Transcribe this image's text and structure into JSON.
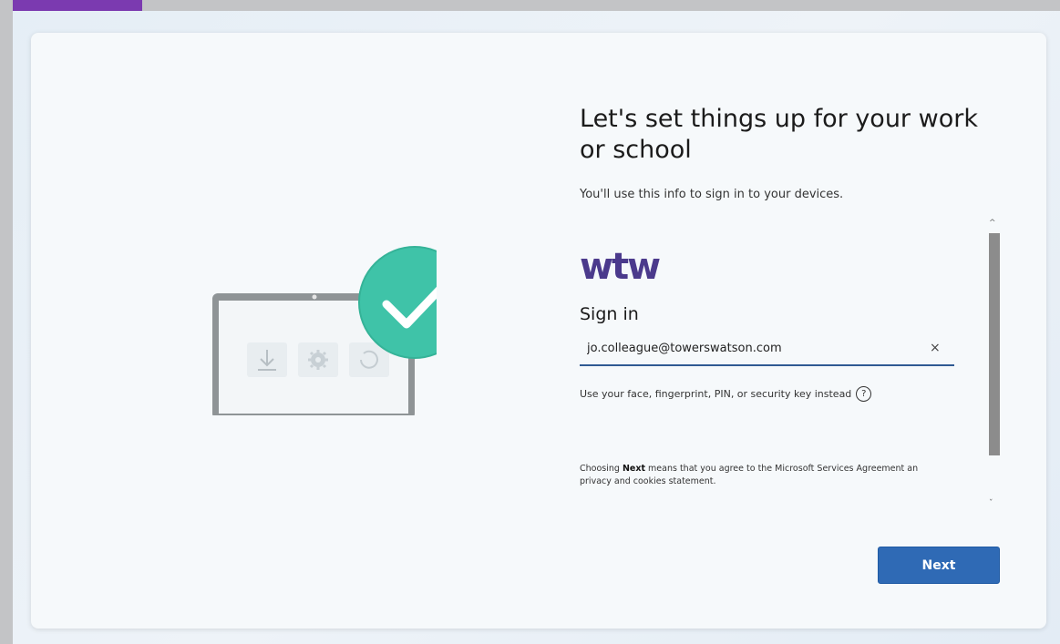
{
  "setup": {
    "title": "Let's set things up for your work or school",
    "subtitle": "You'll use this info to sign in to your devices."
  },
  "brand": {
    "logo_text": "wtw",
    "logo_color": "#4b3a8c"
  },
  "signin": {
    "heading": "Sign in",
    "email_value": "jo.colleague@towerswatson.com",
    "clear_glyph": "×",
    "alt_link": "Use your face, fingerprint, PIN, or security key instead",
    "help_glyph": "?",
    "agreement_bold": "Next",
    "agreement_prefix": "Choosing ",
    "agreement_rest": " means that you agree to the Microsoft Services Agreement an",
    "agreement_line2": "privacy and cookies statement."
  },
  "scroll": {
    "up": "^",
    "down": "ˇ"
  },
  "actions": {
    "next_label": "Next"
  },
  "colors": {
    "accent": "#2f6ab5",
    "check_badge": "#3fc3a8",
    "tab": "#7b3ab0"
  },
  "icons": [
    "download-icon",
    "gear-icon",
    "refresh-icon",
    "checkmark-icon"
  ]
}
